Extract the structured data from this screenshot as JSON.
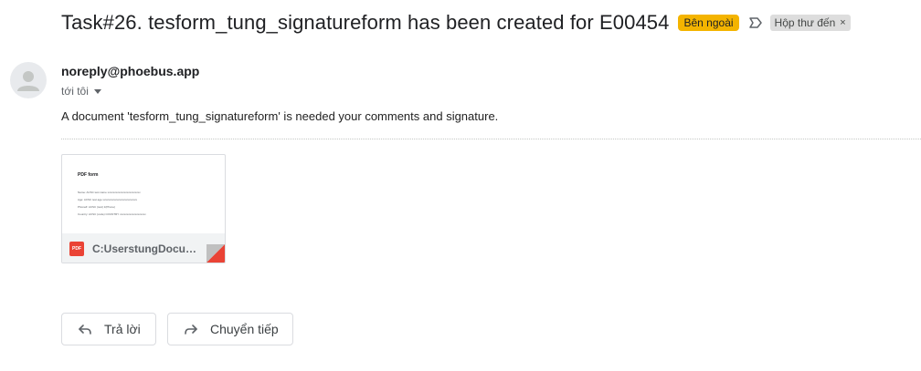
{
  "email": {
    "subject": "Task#26. tesform_tung_signatureform has been created for E00454",
    "labels": {
      "external": "Bên ngoài",
      "inbox": "Hộp thư đến",
      "inbox_remove": "×"
    },
    "sender": "noreply@phoebus.app",
    "recipient": "tới tôi",
    "body": "A document 'tesform_tung_signatureform' is needed your comments and signature."
  },
  "attachment": {
    "filename": "C:UserstungDocuments",
    "type_badge": "PDF",
    "preview": {
      "title": "PDF form",
      "lines": [
        "Name:       ACSC test name xxxxxxxxxxxxxxxxxxxxxxxx",
        "Age:          ACSC test age xxxxxxxxxxxxxxxxxxxxxxxxx",
        "Phone#:     ACSC (test) 1(Phone)",
        "Country:    ACSC (code) COUNTRY xxxxxxxxxxxxxxxxxxx"
      ]
    }
  },
  "actions": {
    "reply": "Trả lời",
    "forward": "Chuyển tiếp"
  },
  "colors": {
    "external_label": "#f4b400",
    "inbox_label": "#dddddd",
    "pdf_red": "#ea4335"
  },
  "icons": {
    "important": "important-marker-icon",
    "avatar": "person-icon",
    "reply": "reply-arrow-icon",
    "forward": "forward-arrow-icon",
    "attachment_type": "pdf-icon"
  }
}
